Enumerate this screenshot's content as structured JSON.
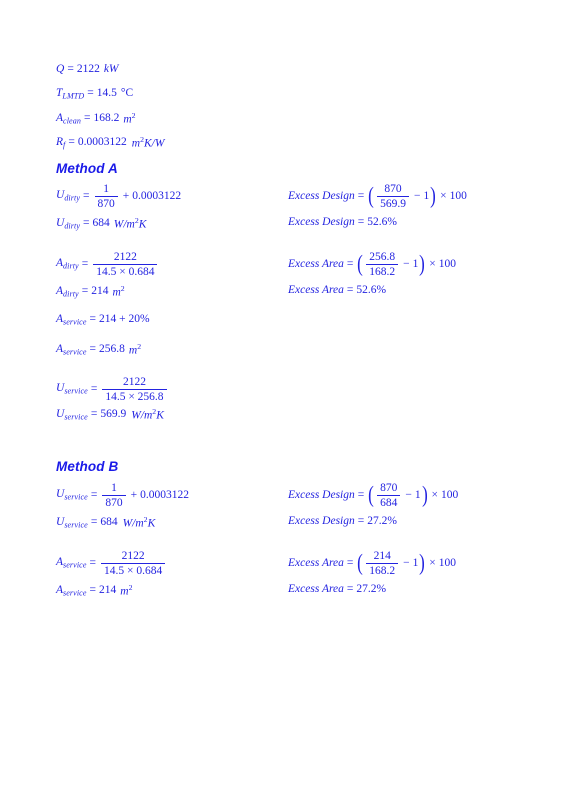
{
  "document": {
    "accent_color": "#2323e0",
    "heading_color": "#1a1ae8",
    "background": "#ffffff"
  },
  "givens": {
    "rows": [
      {
        "lhs": "Q",
        "sub": "",
        "value": "2122",
        "unit": "kW"
      },
      {
        "lhs": "T",
        "sub": "LMTD",
        "value": "14.5",
        "unit": "°C"
      },
      {
        "lhs": "A",
        "sub": "clean",
        "value": "168.2",
        "unit": "m",
        "unit_sup": "2"
      },
      {
        "lhs": "R",
        "sub": "f",
        "value": "0.0003122",
        "unit": "m",
        "unit_sup": "2",
        "unit_tail": "K/W"
      }
    ],
    "q_label": "Q",
    "q_value": "2122",
    "q_unit": "kW",
    "t_label": "T",
    "t_sub": "LMTD",
    "t_value": "14.5",
    "t_unit": "°C",
    "a_label": "A",
    "a_sub": "clean",
    "a_value": "168.2",
    "a_unit": "m",
    "a_unit_sup": "2",
    "r_label": "R",
    "r_sub": "f",
    "r_value": "0.0003122",
    "r_unit": "m",
    "r_unit_sup": "2",
    "r_unit_tail": "K/W"
  },
  "method_a": {
    "title": "Method A",
    "left": {
      "udirty_def": {
        "lhs": "U",
        "sub": "dirty",
        "eq": "=",
        "frac_num": "1",
        "frac_den": "870",
        "op": "+",
        "term": "0.0003122"
      },
      "udirty_val": {
        "lhs": "U",
        "sub": "dirty",
        "eq": "=",
        "value": "684",
        "unit_a": "W/m",
        "unit_sup": "2",
        "unit_b": "K"
      },
      "adirty_def": {
        "lhs": "A",
        "sub": "dirty",
        "eq": "=",
        "frac_num": "2122",
        "frac_den": "14.5 × 0.684"
      },
      "adirty_val": {
        "lhs": "A",
        "sub": "dirty",
        "eq": "=",
        "value": "214",
        "unit": "m",
        "unit_sup": "2"
      },
      "aservice_def": {
        "lhs": "A",
        "sub": "service",
        "eq": "=",
        "value": "214 + 20%"
      },
      "aservice_val": {
        "lhs": "A",
        "sub": "service",
        "eq": "=",
        "value": "256.8",
        "unit": "m",
        "unit_sup": "2"
      },
      "uservice_def": {
        "lhs": "U",
        "sub": "service",
        "eq": "=",
        "frac_num": "2122",
        "frac_den": "14.5 × 256.8"
      },
      "uservice_val": {
        "lhs": "U",
        "sub": "service",
        "eq": "=",
        "value": "569.9",
        "unit_a": "W/m",
        "unit_sup": "2",
        "unit_b": "K"
      }
    },
    "right": {
      "excess_design_def": {
        "label": "Excess Design",
        "eq": "=",
        "frac_num": "870",
        "frac_den": "569.9",
        "op": "−",
        "one": "1",
        "times": "×",
        "hundred": "100"
      },
      "excess_design_val": {
        "label": "Excess Design",
        "eq": "=",
        "value": "52.6%"
      },
      "excess_area_def": {
        "label": "Excess Area",
        "eq": "=",
        "frac_num": "256.8",
        "frac_den": "168.2",
        "op": "−",
        "one": "1",
        "times": "×",
        "hundred": "100"
      },
      "excess_area_val": {
        "label": "Excess Area",
        "eq": "=",
        "value": "52.6%"
      }
    }
  },
  "method_b": {
    "title": "Method B",
    "left": {
      "uservice_def": {
        "lhs": "U",
        "sub": "service",
        "eq": "=",
        "frac_num": "1",
        "frac_den": "870",
        "op": "+",
        "term": "0.0003122"
      },
      "uservice_val": {
        "lhs": "U",
        "sub": "service",
        "eq": "=",
        "value": "684",
        "unit_a": "W/m",
        "unit_sup": "2",
        "unit_b": "K"
      },
      "aservice_def": {
        "lhs": "A",
        "sub": "service",
        "eq": "=",
        "frac_num": "2122",
        "frac_den": "14.5 × 0.684"
      },
      "aservice_val": {
        "lhs": "A",
        "sub": "service",
        "eq": "=",
        "value": "214",
        "unit": "m",
        "unit_sup": "2"
      }
    },
    "right": {
      "excess_design_def": {
        "label": "Excess Design",
        "eq": "=",
        "frac_num": "870",
        "frac_den": "684",
        "op": "−",
        "one": "1",
        "times": "×",
        "hundred": "100"
      },
      "excess_design_val": {
        "label": "Excess Design",
        "eq": "=",
        "value": "27.2%"
      },
      "excess_area_def": {
        "label": "Excess Area",
        "eq": "=",
        "frac_num": "214",
        "frac_den": "168.2",
        "op": "−",
        "one": "1",
        "times": "×",
        "hundred": "100"
      },
      "excess_area_val": {
        "label": "Excess Area",
        "eq": "=",
        "value": "27.2%"
      }
    }
  }
}
